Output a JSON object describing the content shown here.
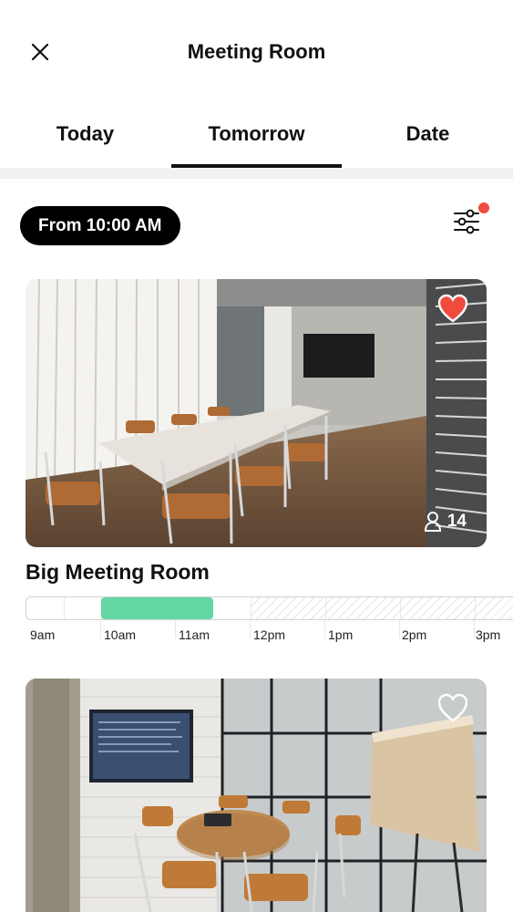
{
  "header": {
    "title": "Meeting Room",
    "close_icon": "close-icon"
  },
  "tabs": [
    {
      "label": "Today"
    },
    {
      "label": "Tomorrow",
      "selected": true
    },
    {
      "label": "Date"
    }
  ],
  "filter": {
    "from_label": "From 10:00 AM",
    "filter_icon": "sliders-icon",
    "has_active_filters": true
  },
  "rooms": [
    {
      "name": "Big Meeting Room",
      "capacity": "14",
      "favorite": true,
      "timeline": {
        "labels": [
          "9am",
          "10am",
          "11am",
          "12pm",
          "1pm",
          "2pm",
          "3pm"
        ],
        "booked_from": "10am",
        "booked_to": "11:30am",
        "unavailable_from": "12pm"
      }
    },
    {
      "name": "",
      "favorite": false
    }
  ],
  "colors": {
    "accent": "#000000",
    "booked": "#63d6a3",
    "favorite": "#ef4b3f",
    "notification_dot": "#ef4b3f"
  }
}
